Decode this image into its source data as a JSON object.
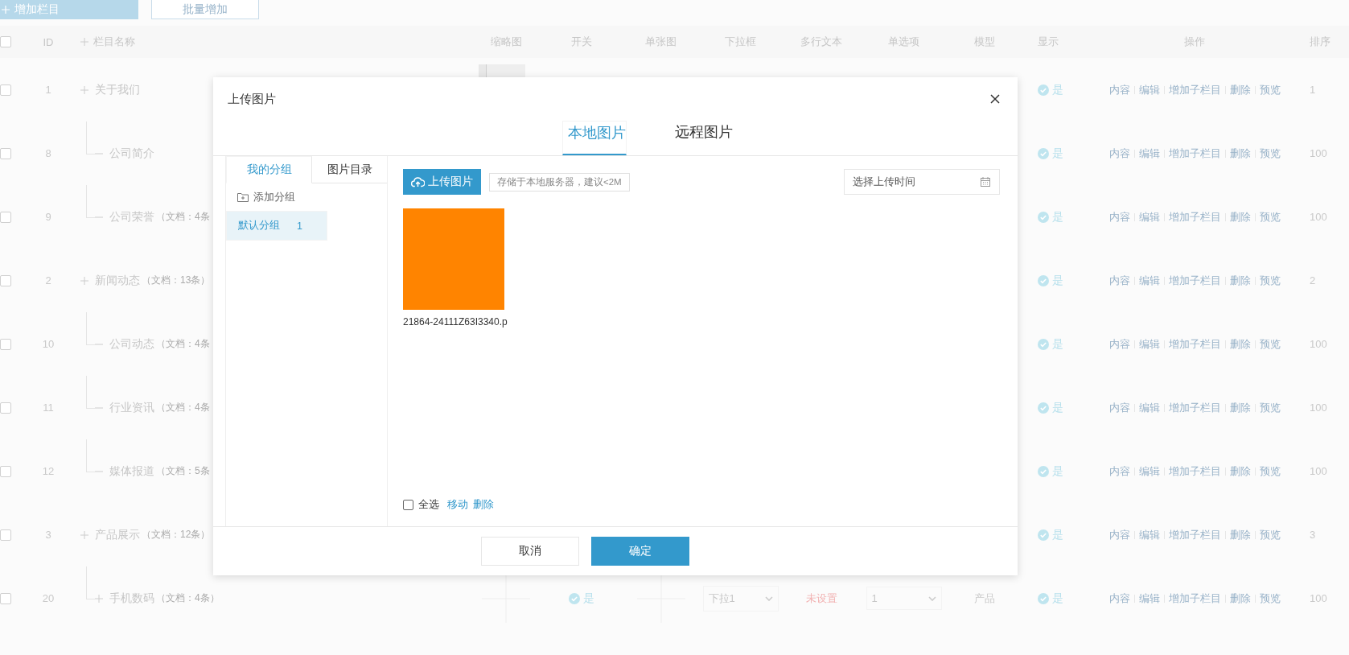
{
  "toolbar": {
    "buttons": [
      {
        "label": "增加栏目",
        "kind": "primary"
      },
      {
        "label": "批量增加",
        "kind": "outline"
      }
    ]
  },
  "table": {
    "select_all": {
      "checked": false
    },
    "columns": [
      {
        "label": "ID"
      },
      {
        "label": "栏目名称",
        "kind": "tree"
      },
      {
        "label": "缩略图"
      },
      {
        "label": "开关"
      },
      {
        "label": "单张图"
      },
      {
        "label": "下拉框"
      },
      {
        "label": "多行文本"
      },
      {
        "label": "单选项"
      },
      {
        "label": "模型"
      },
      {
        "label": "显示",
        "kind": "left"
      },
      {
        "label": "操作"
      },
      {
        "label": "排序",
        "kind": "left"
      }
    ],
    "rows": [
      {
        "id": "1",
        "name": "关于我们",
        "expandable": true,
        "checked": false,
        "thumbnail": {
          "kind": "photo"
        },
        "show": "是",
        "actions": [
          "内容",
          "编辑",
          "增加子栏目",
          "删除",
          "预览"
        ],
        "sort": "1",
        "children": [
          {
            "id": "8",
            "name": "公司简介",
            "expandable": false,
            "checked": false,
            "show": "是",
            "actions": [
              "内容",
              "编辑",
              "增加子栏目",
              "删除",
              "预览"
            ],
            "sort": "100"
          },
          {
            "id": "9",
            "name": "公司荣誉",
            "note": "（文档：4条",
            "expandable": false,
            "checked": false,
            "show": "是",
            "actions": [
              "内容",
              "编辑",
              "增加子栏目",
              "删除",
              "预览"
            ],
            "sort": "100"
          }
        ]
      },
      {
        "id": "2",
        "name": "新闻动态",
        "note": "（文档：13条）",
        "expandable": true,
        "checked": false,
        "show": "是",
        "actions": [
          "内容",
          "编辑",
          "增加子栏目",
          "删除",
          "预览"
        ],
        "sort": "2",
        "children": [
          {
            "id": "10",
            "name": "公司动态",
            "note": "（文档：4条",
            "expandable": false,
            "checked": false,
            "show": "是",
            "actions": [
              "内容",
              "编辑",
              "增加子栏目",
              "删除",
              "预览"
            ],
            "sort": "100"
          },
          {
            "id": "11",
            "name": "行业资讯",
            "note": "（文档：4条",
            "expandable": false,
            "checked": false,
            "show": "是",
            "actions": [
              "内容",
              "编辑",
              "增加子栏目",
              "删除",
              "预览"
            ],
            "sort": "100"
          },
          {
            "id": "12",
            "name": "媒体报道",
            "note": "（文档：5条",
            "expandable": false,
            "checked": false,
            "show": "是",
            "actions": [
              "内容",
              "编辑",
              "增加子栏目",
              "删除",
              "预览"
            ],
            "sort": "100"
          }
        ]
      },
      {
        "id": "3",
        "name": "产品展示",
        "note": "（文档：12条）",
        "expandable": true,
        "checked": false,
        "show": "是",
        "actions": [
          "内容",
          "编辑",
          "增加子栏目",
          "删除",
          "预览"
        ],
        "sort": "3",
        "children": [
          {
            "id": "20",
            "name": "手机数码",
            "note": "（文档：4条）",
            "expandable": true,
            "checked": false,
            "thumbnail": {
              "kind": "empty"
            },
            "switch": "是",
            "image": {
              "kind": "empty"
            },
            "dropdown": "下拉1",
            "multiline": "未设置",
            "radio": "1",
            "model": "产品",
            "show": "是",
            "actions": [
              "内容",
              "编辑",
              "增加子栏目",
              "删除",
              "预览"
            ],
            "sort": "100"
          }
        ]
      }
    ]
  },
  "dialog": {
    "title": "上传图片",
    "tabs": [
      {
        "label": "本地图片",
        "selected": true
      },
      {
        "label": "远程图片",
        "selected": false
      }
    ],
    "side_tabs": [
      {
        "label": "我的分组",
        "selected": true
      },
      {
        "label": "图片目录",
        "selected": false
      }
    ],
    "add_group": "添加分组",
    "groups": [
      {
        "name": "默认分组",
        "count": "1",
        "selected": true
      }
    ],
    "upload_button": "上传图片",
    "upload_tip": "存储于本地服务器，建议<2M",
    "date_field": {
      "placeholder": "选择上传时间"
    },
    "images": [
      {
        "filename": "21864-24111Z63I3340.p",
        "checked": false
      }
    ],
    "select_all": {
      "label": "全选",
      "checked": false
    },
    "links": [
      "移动",
      "删除"
    ],
    "buttons": [
      {
        "label": "取消",
        "kind": "default"
      },
      {
        "label": "确定",
        "kind": "primary"
      }
    ]
  }
}
